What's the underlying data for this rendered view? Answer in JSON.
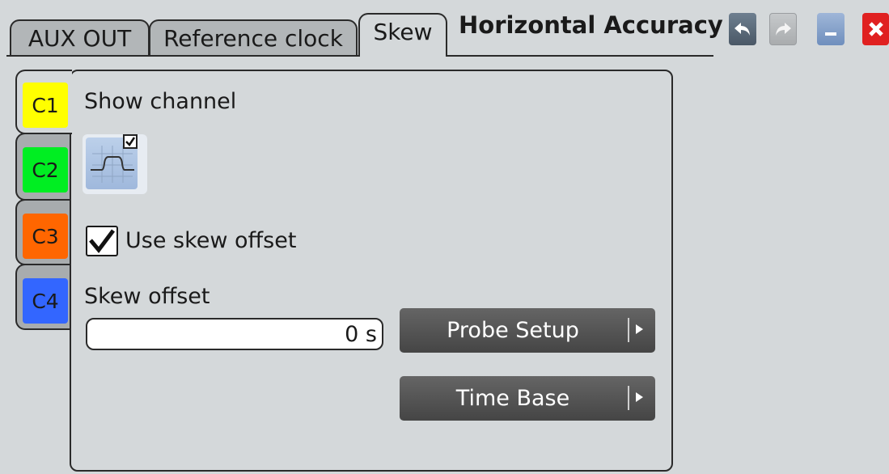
{
  "tabs": [
    {
      "label": "AUX OUT"
    },
    {
      "label": "Reference clock"
    },
    {
      "label": "Skew"
    }
  ],
  "title": "Horizontal Accuracy",
  "window_buttons": {
    "undo_icon": "undo-arrow-icon",
    "redo_icon": "redo-arrow-icon",
    "minimize_icon": "minimize-icon",
    "close_icon": "close-icon",
    "close_color": "#e02020"
  },
  "channels": [
    {
      "label": "C1",
      "color": "#ffff00"
    },
    {
      "label": "C2",
      "color": "#00ee22"
    },
    {
      "label": "C3",
      "color": "#ff6600"
    },
    {
      "label": "C4",
      "color": "#3366ff"
    }
  ],
  "show_channel": {
    "label": "Show channel",
    "icon": "waveform-icon",
    "checked": true
  },
  "use_skew_offset": {
    "label": "Use skew offset",
    "checked": true
  },
  "skew_offset": {
    "label": "Skew offset",
    "value": "0 s"
  },
  "buttons": {
    "probe_setup": "Probe Setup",
    "time_base": "Time Base"
  }
}
